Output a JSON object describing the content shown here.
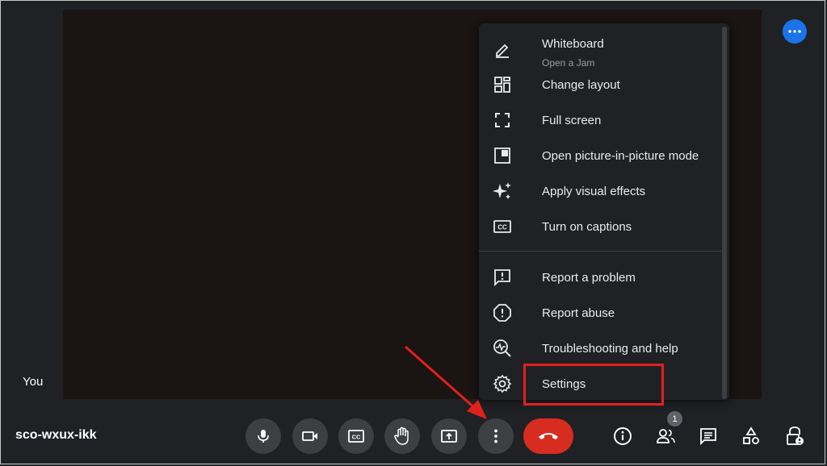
{
  "meeting": {
    "code": "sco-wxux-ikk",
    "self_label": "You",
    "participant_count": "1"
  },
  "menu": {
    "items": [
      {
        "label": "Whiteboard",
        "sublabel": "Open a Jam",
        "icon": "pen-icon"
      },
      {
        "label": "Change layout",
        "icon": "layout-icon"
      },
      {
        "label": "Full screen",
        "icon": "fullscreen-icon"
      },
      {
        "label": "Open picture-in-picture mode",
        "icon": "picture-in-picture-icon"
      },
      {
        "label": "Apply visual effects",
        "icon": "sparkle-icon"
      },
      {
        "label": "Turn on captions",
        "icon": "captions-icon"
      },
      {
        "label": "Report a problem",
        "icon": "feedback-icon"
      },
      {
        "label": "Report abuse",
        "icon": "report-icon"
      },
      {
        "label": "Troubleshooting and help",
        "icon": "troubleshoot-icon"
      },
      {
        "label": "Settings",
        "icon": "gear-icon"
      }
    ]
  },
  "colors": {
    "background": "#202124",
    "control": "#3c4043",
    "hangup": "#d62d20",
    "accent": "#1a73e8",
    "annotation": "#e0211b"
  }
}
